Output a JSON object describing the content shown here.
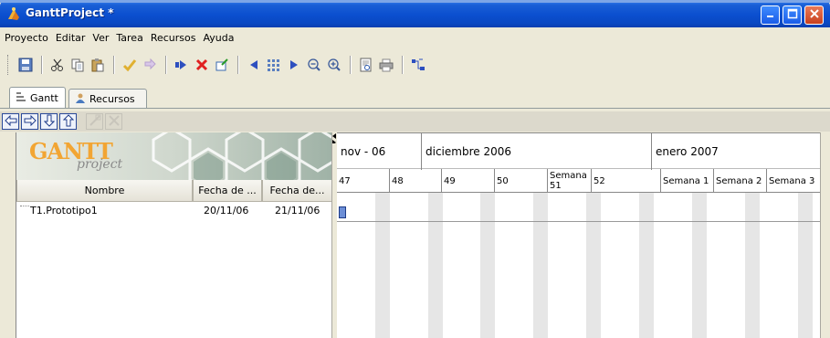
{
  "window": {
    "title": "GanttProject *"
  },
  "menu": [
    "Proyecto",
    "Editar",
    "Ver",
    "Tarea",
    "Recursos",
    "Ayuda"
  ],
  "toolbar": {
    "icons": [
      "save-icon",
      "cut-icon",
      "copy-icon",
      "paste-icon",
      "undo-icon",
      "redo-icon",
      "indent-icon",
      "delete-icon",
      "properties-icon",
      "scroll-left-icon",
      "center-icon",
      "scroll-right-icon",
      "zoom-out-icon",
      "zoom-in-icon",
      "preview-icon",
      "print-icon",
      "critical-path-icon"
    ]
  },
  "tabs": [
    {
      "label": "Gantt",
      "active": true
    },
    {
      "label": "Recursos",
      "active": false
    }
  ],
  "logo": {
    "main": "GANTT",
    "sub": "project"
  },
  "table": {
    "columns": [
      "Nombre",
      "Fecha de ...",
      "Fecha de..."
    ],
    "rows": [
      {
        "name": "T1.Prototipo1",
        "start": "20/11/06",
        "end": "21/11/06"
      }
    ]
  },
  "chart": {
    "months": [
      "nov - 06",
      "diciembre 2006",
      "enero 2007"
    ],
    "weeks": [
      "47",
      "48",
      "49",
      "50",
      "Semana 51",
      "52",
      "Semana 1",
      "Semana 2",
      "Semana 3"
    ]
  },
  "colors": {
    "titlebar": "#0b4fcf",
    "taskbar": "#6c8ed6",
    "close": "#c8401e"
  }
}
